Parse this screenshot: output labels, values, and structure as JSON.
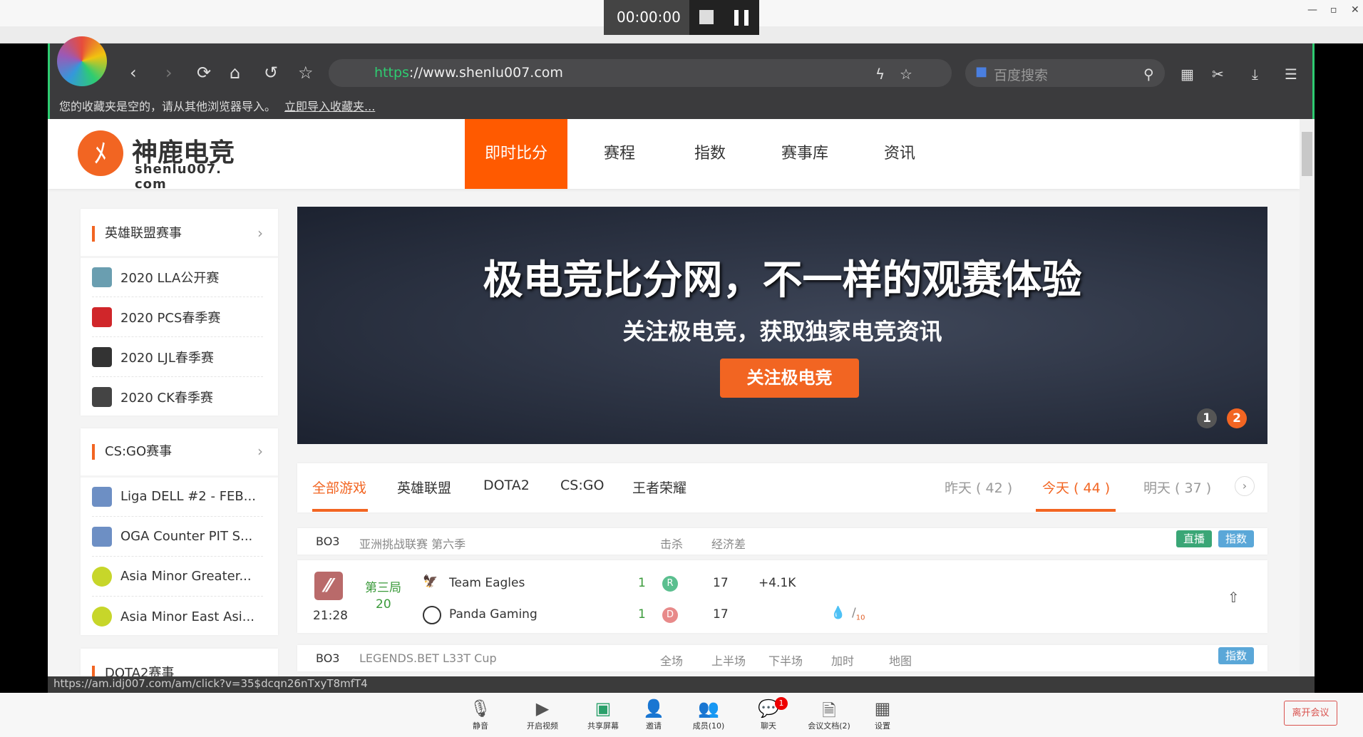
{
  "meeting": {
    "timer": "00:00:00",
    "leave": "离开会议",
    "tools": [
      {
        "label": "静音",
        "icon": "microphone-icon"
      },
      {
        "label": "开启视频",
        "icon": "video-off-icon"
      },
      {
        "label": "共享屏幕",
        "icon": "share-screen-icon"
      },
      {
        "label": "邀请",
        "icon": "invite-icon"
      },
      {
        "label": "成员(10)",
        "icon": "members-icon"
      },
      {
        "label": "聊天",
        "icon": "chat-icon",
        "badge": "1"
      },
      {
        "label": "会议文档(2)",
        "icon": "document-icon"
      },
      {
        "label": "设置",
        "icon": "settings-icon"
      }
    ]
  },
  "browser": {
    "url_scheme": "https",
    "url_rest": "://www.shenlu007.com",
    "search_placeholder": "百度搜索",
    "bookmark_msg": "您的收藏夹是空的，请从其他浏览器导入。",
    "bookmark_link": "立即导入收藏夹...",
    "status_url": "https://am.idj007.com/am/click?v=35$dcqn26nTxyT8mfT4"
  },
  "site": {
    "logo_cn": "神鹿电竞",
    "logo_en": "shenlu007. com",
    "nav": [
      "即时比分",
      "赛程",
      "指数",
      "赛事库",
      "资讯"
    ],
    "sidebar": [
      {
        "title": "英雄联盟赛事",
        "items": [
          "2020 LLA公开赛",
          "2020 PCS春季赛",
          "2020 LJL春季赛",
          "2020 CK春季赛"
        ]
      },
      {
        "title": "CS:GO赛事",
        "items": [
          "Liga DELL #2 - FEB...",
          "OGA Counter PIT S...",
          "Asia Minor Greater...",
          "Asia Minor East Asi..."
        ]
      },
      {
        "title": "DOTA2赛事",
        "items": []
      }
    ],
    "banner": {
      "headline": "极电竞比分网，不一样的观赛体验",
      "sub": "关注极电竞，获取独家电竞资讯",
      "button": "关注极电竞",
      "pages": [
        "1",
        "2"
      ]
    },
    "game_tabs": [
      "全部游戏",
      "英雄联盟",
      "DOTA2",
      "CS:GO",
      "王者荣耀"
    ],
    "day_tabs": [
      "昨天 ( 42 )",
      "今天 ( 44 )",
      "明天 ( 37 )"
    ],
    "matches": [
      {
        "format": "BO3",
        "league": "亚洲挑战联赛 第六季",
        "cols": [
          "击杀",
          "经济差"
        ],
        "badges": [
          "直播",
          "指数"
        ],
        "time": "21:28",
        "game_label": "第三局",
        "game_min": "20",
        "teams": [
          {
            "name": "Team Eagles",
            "score": "1",
            "side": "R",
            "kills": "17",
            "gold": "+4.1K"
          },
          {
            "name": "Panda Gaming",
            "score": "1",
            "side": "D",
            "kills": "17",
            "gold": ""
          }
        ],
        "first_blood_icon": "blood-drop-icon",
        "ten_kills": "10"
      },
      {
        "format": "BO3",
        "league": "LEGENDS.BET L33T Cup",
        "cols": [
          "全场",
          "上半场",
          "下半场",
          "加时",
          "地图"
        ],
        "badges": [
          "指数"
        ]
      }
    ]
  },
  "colors": {
    "accent": "#ff5a00",
    "live": "#3aa676",
    "index": "#5aa7d8",
    "radiant": "#5bbf8f",
    "dire": "#e88a8a"
  }
}
